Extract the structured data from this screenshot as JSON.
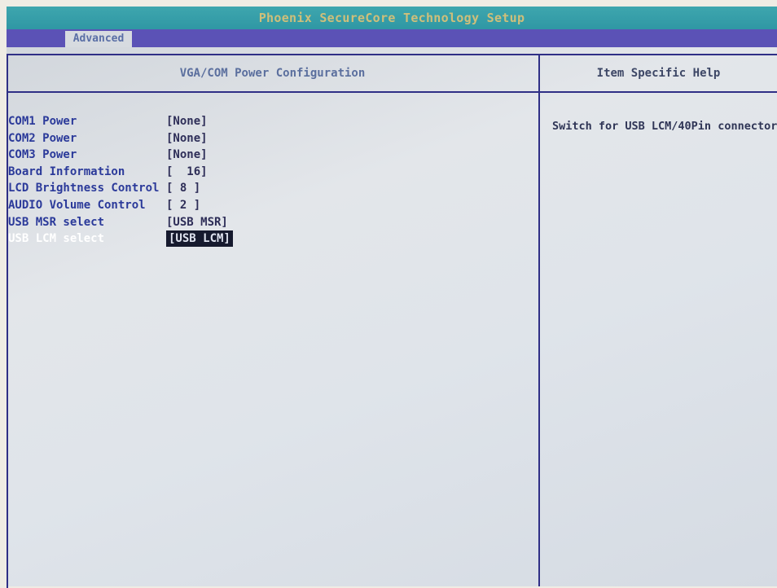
{
  "app": {
    "title": "Phoenix SecureCore Technology Setup"
  },
  "menu": {
    "active_tab": "Advanced"
  },
  "main": {
    "section_title": "VGA/COM Power Configuration",
    "settings": [
      {
        "label": "COM1 Power",
        "value": "[None]"
      },
      {
        "label": "COM2 Power",
        "value": "[None]"
      },
      {
        "label": "COM3 Power",
        "value": "[None]"
      },
      {
        "label": "Board Information",
        "value": "[  16]"
      },
      {
        "label": "LCD Brightness Control",
        "value": "[ 8 ]"
      },
      {
        "label": "AUDIO Volume Control",
        "value": "[ 2 ]"
      },
      {
        "label": "USB MSR select",
        "value": "[USB MSR]"
      },
      {
        "label": "USB LCM select",
        "value": "[USB LCM]",
        "selected": true
      }
    ]
  },
  "help": {
    "title": "Item Specific Help",
    "text": "Switch for USB LCM/40Pin connector"
  },
  "colors": {
    "title_bar": "#2f97a4",
    "menu_bar": "#5b52b6",
    "label_text": "#2b3a9a",
    "selected_label": "#ffffff",
    "selected_value_bg": "#161a2e"
  }
}
